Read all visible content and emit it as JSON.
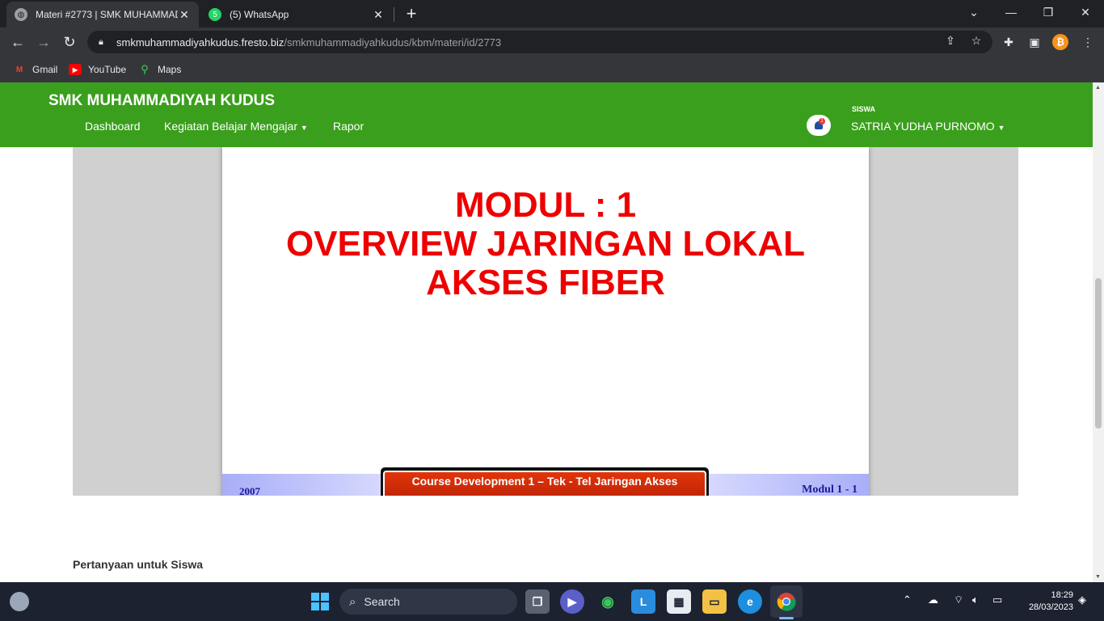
{
  "browser": {
    "tabs": [
      {
        "title": "Materi #2773 | SMK MUHAMMADIYAH KUDUS",
        "active": true
      },
      {
        "title": "(5) WhatsApp",
        "active": false,
        "badge": "5"
      }
    ],
    "url_host": "smkmuhammadiyahkudus.fresto.biz",
    "url_path": "/smkmuhammadiyahkudus/kbm/materi/id/2773",
    "bookmarks": [
      {
        "label": "Gmail",
        "icon": "gmail-icon"
      },
      {
        "label": "YouTube",
        "icon": "youtube-icon"
      },
      {
        "label": "Maps",
        "icon": "maps-icon"
      }
    ]
  },
  "site": {
    "brand": "SMK MUHAMMADIYAH KUDUS",
    "menu": {
      "dashboard": "Dashboard",
      "kbm": "Kegiatan Belajar Mengajar",
      "rapor": "Rapor"
    },
    "notification_count": "1",
    "user_role": "SISWA",
    "user_name": "SATRIA YUDHA PURNOMO",
    "accent_color": "#3a9f1c"
  },
  "slide": {
    "title_lines": [
      "MODUL : 1",
      "OVERVIEW JARINGAN LOKAL",
      "AKSES FIBER"
    ],
    "footer_year": "2007",
    "footer_center": "Course Development 1 – Tek -  Tel Jaringan Akses",
    "footer_right": "Modul 1 - 1",
    "title_color": "#ee0000"
  },
  "content": {
    "question_label": "Pertanyaan untuk Siswa"
  },
  "taskbar": {
    "search_label": "Search",
    "time": "18:29",
    "date": "28/03/2023"
  }
}
